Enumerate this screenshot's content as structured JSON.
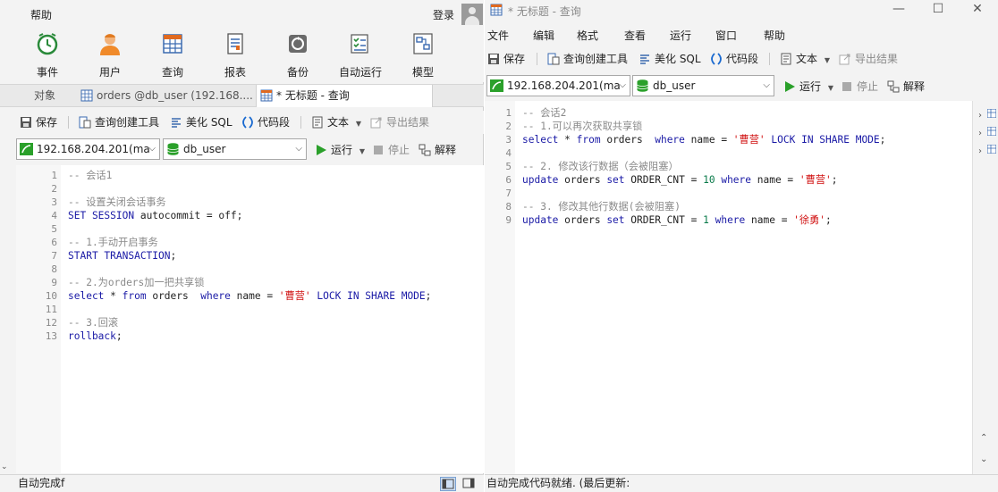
{
  "left": {
    "menubar": {
      "partial_item": "",
      "help": "帮助",
      "login": "登录"
    },
    "ribbon": [
      {
        "label": "事件",
        "icon": "clock-icon"
      },
      {
        "label": "用户",
        "icon": "user-icon"
      },
      {
        "label": "查询",
        "icon": "query-grid-icon"
      },
      {
        "label": "报表",
        "icon": "report-icon"
      },
      {
        "label": "备份",
        "icon": "backup-icon"
      },
      {
        "label": "自动运行",
        "icon": "checklist-icon"
      },
      {
        "label": "模型",
        "icon": "model-icon"
      }
    ],
    "tabs": {
      "objects": "对象",
      "orders": "orders @db_user (192.168....",
      "query": "* 无标题 - 查询"
    },
    "toolbar": {
      "save": "保存",
      "builder": "查询创建工具",
      "beautify": "美化 SQL",
      "snippet": "代码段",
      "text": "文本",
      "export": "导出结果"
    },
    "connection": {
      "host": "192.168.204.201(ma",
      "database": "db_user",
      "run": "运行",
      "stop": "停止",
      "explain": "解释"
    },
    "code": [
      {
        "n": "1",
        "parts": [
          {
            "t": "-- 会话1",
            "c": "cm"
          }
        ]
      },
      {
        "n": "2",
        "parts": []
      },
      {
        "n": "3",
        "parts": [
          {
            "t": "-- 设置关闭会话事务",
            "c": "cm"
          }
        ]
      },
      {
        "n": "4",
        "parts": [
          {
            "t": "SET SESSION",
            "c": "kw"
          },
          {
            "t": " autocommit = off;",
            "c": "tx"
          }
        ]
      },
      {
        "n": "5",
        "parts": []
      },
      {
        "n": "6",
        "parts": [
          {
            "t": "-- 1.手动开启事务",
            "c": "cm"
          }
        ]
      },
      {
        "n": "7",
        "parts": [
          {
            "t": "START TRANSACTION",
            "c": "kw"
          },
          {
            "t": ";",
            "c": "tx"
          }
        ]
      },
      {
        "n": "8",
        "parts": []
      },
      {
        "n": "9",
        "parts": [
          {
            "t": "-- 2.为orders加一把共享锁",
            "c": "cm"
          }
        ]
      },
      {
        "n": "10",
        "parts": [
          {
            "t": "select",
            "c": "kw"
          },
          {
            "t": " * ",
            "c": "tx"
          },
          {
            "t": "from",
            "c": "kw"
          },
          {
            "t": " orders  ",
            "c": "tx"
          },
          {
            "t": "where",
            "c": "kw"
          },
          {
            "t": " name = ",
            "c": "tx"
          },
          {
            "t": "'曹营'",
            "c": "str"
          },
          {
            "t": " ",
            "c": "tx"
          },
          {
            "t": "LOCK IN SHARE MODE",
            "c": "kw"
          },
          {
            "t": ";",
            "c": "tx"
          }
        ]
      },
      {
        "n": "11",
        "parts": []
      },
      {
        "n": "12",
        "parts": [
          {
            "t": "-- 3.回滚",
            "c": "cm"
          }
        ]
      },
      {
        "n": "13",
        "parts": [
          {
            "t": "rollback",
            "c": "kw"
          },
          {
            "t": ";",
            "c": "tx"
          }
        ]
      }
    ],
    "status": "自动完成f"
  },
  "right": {
    "title": "* 无标题 - 查询",
    "menubar": [
      "文件",
      "编辑",
      "格式",
      "查看",
      "运行",
      "窗口",
      "帮助"
    ],
    "toolbar": {
      "save": "保存",
      "builder": "查询创建工具",
      "beautify": "美化 SQL",
      "snippet": "代码段",
      "text": "文本",
      "export": "导出结果"
    },
    "connection": {
      "host": "192.168.204.201(ma",
      "database": "db_user",
      "run": "运行",
      "stop": "停止",
      "explain": "解释"
    },
    "code": [
      {
        "n": "1",
        "parts": [
          {
            "t": "-- 会话2",
            "c": "cm"
          }
        ]
      },
      {
        "n": "2",
        "parts": [
          {
            "t": "-- 1.可以再次获取共享锁",
            "c": "cm"
          }
        ]
      },
      {
        "n": "3",
        "parts": [
          {
            "t": "select",
            "c": "kw"
          },
          {
            "t": " * ",
            "c": "tx"
          },
          {
            "t": "from",
            "c": "kw"
          },
          {
            "t": " orders  ",
            "c": "tx"
          },
          {
            "t": "where",
            "c": "kw"
          },
          {
            "t": " name = ",
            "c": "tx"
          },
          {
            "t": "'曹营'",
            "c": "str"
          },
          {
            "t": " ",
            "c": "tx"
          },
          {
            "t": "LOCK IN SHARE MODE",
            "c": "kw"
          },
          {
            "t": ";",
            "c": "tx"
          }
        ]
      },
      {
        "n": "4",
        "parts": []
      },
      {
        "n": "5",
        "parts": [
          {
            "t": "-- 2. 修改该行数据（会被阻塞）",
            "c": "cm"
          }
        ]
      },
      {
        "n": "6",
        "parts": [
          {
            "t": "update",
            "c": "kw"
          },
          {
            "t": " orders ",
            "c": "tx"
          },
          {
            "t": "set",
            "c": "kw"
          },
          {
            "t": " ORDER_CNT = ",
            "c": "tx"
          },
          {
            "t": "10",
            "c": "num"
          },
          {
            "t": " ",
            "c": "tx"
          },
          {
            "t": "where",
            "c": "kw"
          },
          {
            "t": " name = ",
            "c": "tx"
          },
          {
            "t": "'曹营'",
            "c": "str"
          },
          {
            "t": ";",
            "c": "tx"
          }
        ]
      },
      {
        "n": "7",
        "parts": []
      },
      {
        "n": "8",
        "parts": [
          {
            "t": "-- 3. 修改其他行数据(会被阻塞)",
            "c": "cm"
          }
        ]
      },
      {
        "n": "9",
        "parts": [
          {
            "t": "update",
            "c": "kw"
          },
          {
            "t": " orders ",
            "c": "tx"
          },
          {
            "t": "set",
            "c": "kw"
          },
          {
            "t": " ORDER_CNT = ",
            "c": "tx"
          },
          {
            "t": "1",
            "c": "num"
          },
          {
            "t": " ",
            "c": "tx"
          },
          {
            "t": "where",
            "c": "kw"
          },
          {
            "t": " name = ",
            "c": "tx"
          },
          {
            "t": "'徐勇'",
            "c": "str"
          },
          {
            "t": ";",
            "c": "tx"
          }
        ]
      }
    ],
    "status": "自动完成代码就绪. (最后更新:"
  },
  "colors": {
    "keyword": "#1a1aa6",
    "comment": "#8a8a8a",
    "string": "#d01010",
    "number": "#0a7a4a",
    "run_green": "#2aa02a"
  }
}
